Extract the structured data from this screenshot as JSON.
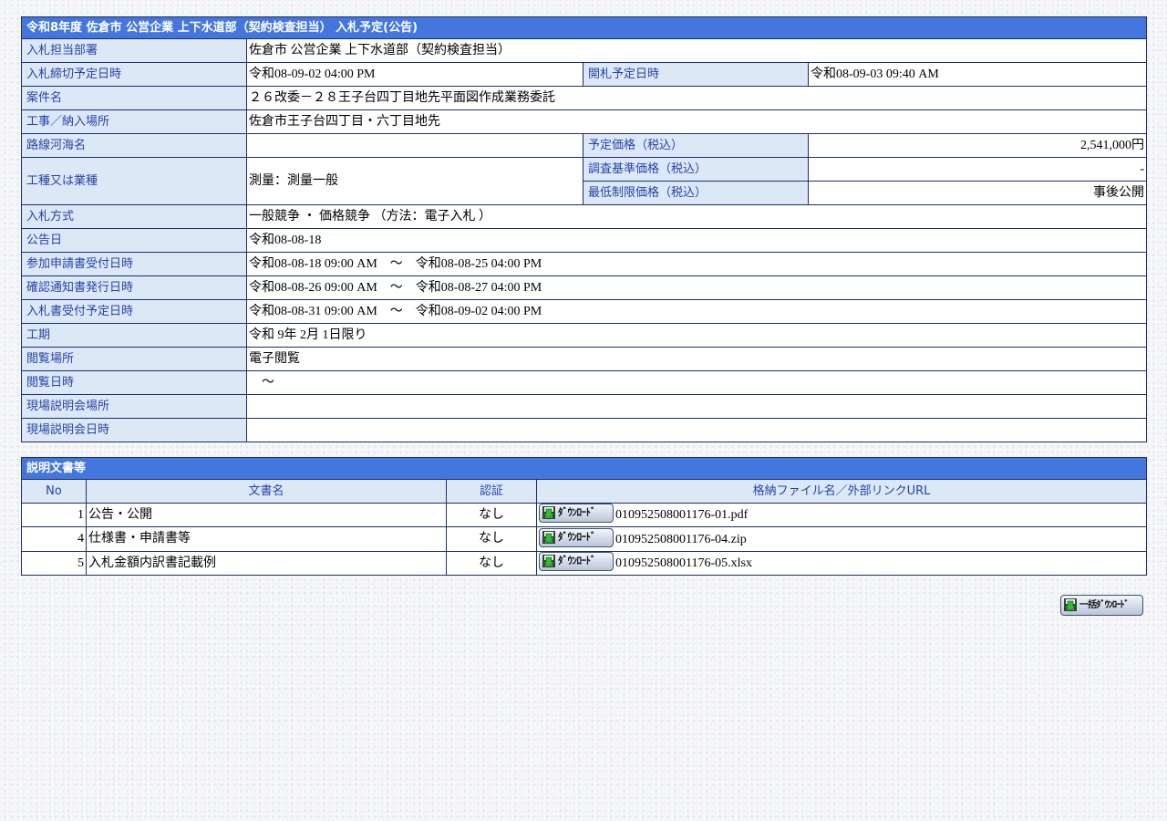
{
  "notice": {
    "title": "令和8年度 佐倉市 公営企業 上下水道部（契約検査担当） 入札予定(公告)",
    "rows": {
      "dept": {
        "label": "入札担当部署",
        "value": "佐倉市 公営企業 上下水道部（契約検査担当）"
      },
      "deadline": {
        "label": "入札締切予定日時",
        "value": "令和08-09-02 04:00 PM"
      },
      "opening": {
        "label": "開札予定日時",
        "value": "令和08-09-03 09:40 AM"
      },
      "case_name": {
        "label": "案件名",
        "value": "２６改委－２８王子台四丁目地先平面図作成業務委託"
      },
      "location": {
        "label": "工事／納入場所",
        "value": "佐倉市王子台四丁目・六丁目地先"
      },
      "route": {
        "label": "路線河海名",
        "value": ""
      },
      "planned_price": {
        "label": "予定価格（税込）",
        "value": "2,541,000円"
      },
      "industry": {
        "label": "工種又は業種",
        "value": "測量：測量一般"
      },
      "survey_price": {
        "label": "調査基準価格（税込）",
        "value": "-"
      },
      "min_price": {
        "label": "最低制限価格（税込）",
        "value": "事後公開"
      },
      "method": {
        "label": "入札方式",
        "value": "一般競争 ・ 価格競争 （方法：電子入札 ）"
      },
      "announce_date": {
        "label": "公告日",
        "value": "令和08-08-18"
      },
      "application": {
        "label": "参加申請書受付日時",
        "value": "令和08-08-18 09:00 AM　～　令和08-08-25 04:00 PM"
      },
      "confirmation": {
        "label": "確認通知書発行日時",
        "value": "令和08-08-26 09:00 AM　～　令和08-08-27 04:00 PM"
      },
      "bid_receipt": {
        "label": "入札書受付予定日時",
        "value": "令和08-08-31 09:00 AM　～　令和08-09-02 04:00 PM"
      },
      "period": {
        "label": "工期",
        "value": "令和 9年 2月 1日限り"
      },
      "view_place": {
        "label": "閲覧場所",
        "value": "電子閲覧"
      },
      "view_date": {
        "label": "閲覧日時",
        "value": "　～"
      },
      "site_place": {
        "label": "現場説明会場所",
        "value": ""
      },
      "site_date": {
        "label": "現場説明会日時",
        "value": ""
      }
    }
  },
  "documents": {
    "title": "説明文書等",
    "headers": {
      "no": "No",
      "name": "文書名",
      "auth": "認証",
      "file": "格納ファイル名／外部リンクURL"
    },
    "download_label": "ﾀﾞｳﾝﾛｰﾄﾞ",
    "items": [
      {
        "no": "1",
        "name": "公告・公開",
        "auth": "なし",
        "file": "010952508001176-01.pdf"
      },
      {
        "no": "4",
        "name": "仕様書・申請書等",
        "auth": "なし",
        "file": "010952508001176-04.zip"
      },
      {
        "no": "5",
        "name": "入札金額内訳書記載例",
        "auth": "なし",
        "file": "010952508001176-05.xlsx"
      }
    ]
  },
  "bulk_download_label": "一括ﾀﾞｳﾝﾛｰﾄﾞ"
}
